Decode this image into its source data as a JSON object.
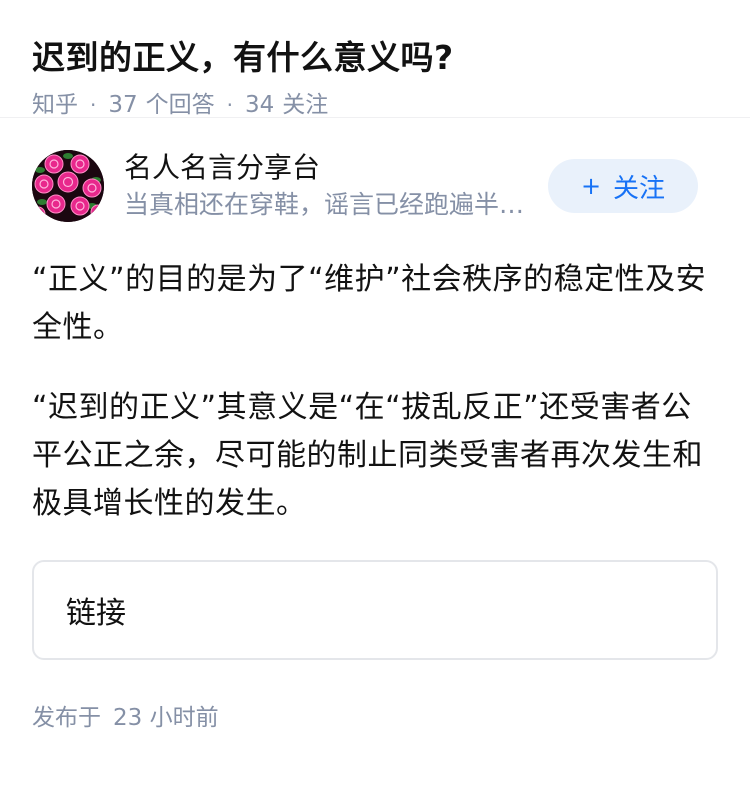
{
  "question": {
    "title": "迟到的正义，有什么意义吗?",
    "meta": {
      "source": "知乎",
      "answer_count": "37",
      "answer_label": "个回答",
      "follower_count": "34",
      "follower_label": "关注"
    }
  },
  "answer": {
    "author": {
      "name": "名人名言分享台",
      "bio": "当真相还在穿鞋，谣言已经跑遍半个世界",
      "avatar_icon": "rose-bouquet-avatar"
    },
    "follow_button": {
      "icon": "+",
      "label": "关注"
    },
    "paragraphs": [
      "“正义”的目的是为了“维护”社会秩序的稳定性及安全性。",
      "“迟到的正义”其意义是“在“拔乱反正”还受害者公平公正之余，尽可能的制止同类受害者再次发生和极具增长性的发生。"
    ],
    "link_card": {
      "label": "链接"
    },
    "publish": {
      "prefix": "发布于",
      "time": "23 小时前"
    }
  },
  "colors": {
    "title": "#121212",
    "meta": "#8590a6",
    "accent": "#1772f6",
    "follow_bg": "#e9f1fb",
    "border": "#e4e6ea"
  }
}
